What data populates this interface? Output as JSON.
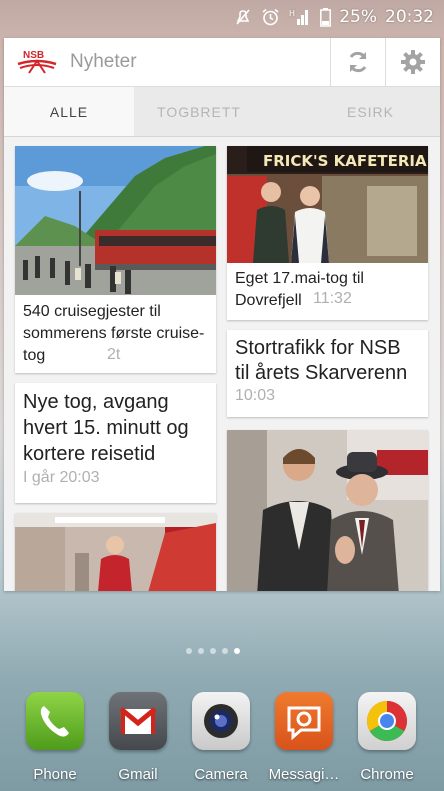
{
  "status_bar": {
    "battery": "25%",
    "time": "20:32"
  },
  "widget": {
    "title": "Nyheter",
    "tabs": [
      {
        "label": "ALLE"
      },
      {
        "label": "TOGBRETT"
      },
      {
        "label": "ESIRK"
      }
    ],
    "cards": [
      {
        "title": "540 cruisegjester til sommerens første cruise-tog",
        "time": "2t"
      },
      {
        "title": "Eget 17.mai-tog til Dovrefjell",
        "time": "11:32"
      },
      {
        "title": "Stortrafikk for NSB til årets Skarverenn",
        "time": "10:03"
      },
      {
        "title": "Nye tog, avgang hvert 15. minutt og kortere reisetid",
        "time": "I går 20:03"
      }
    ],
    "photo_sign_text": "FRICK'S KAFETERIA"
  },
  "dock": [
    {
      "label": "Phone"
    },
    {
      "label": "Gmail"
    },
    {
      "label": "Camera"
    },
    {
      "label": "Messagi…"
    },
    {
      "label": "Chrome"
    }
  ]
}
